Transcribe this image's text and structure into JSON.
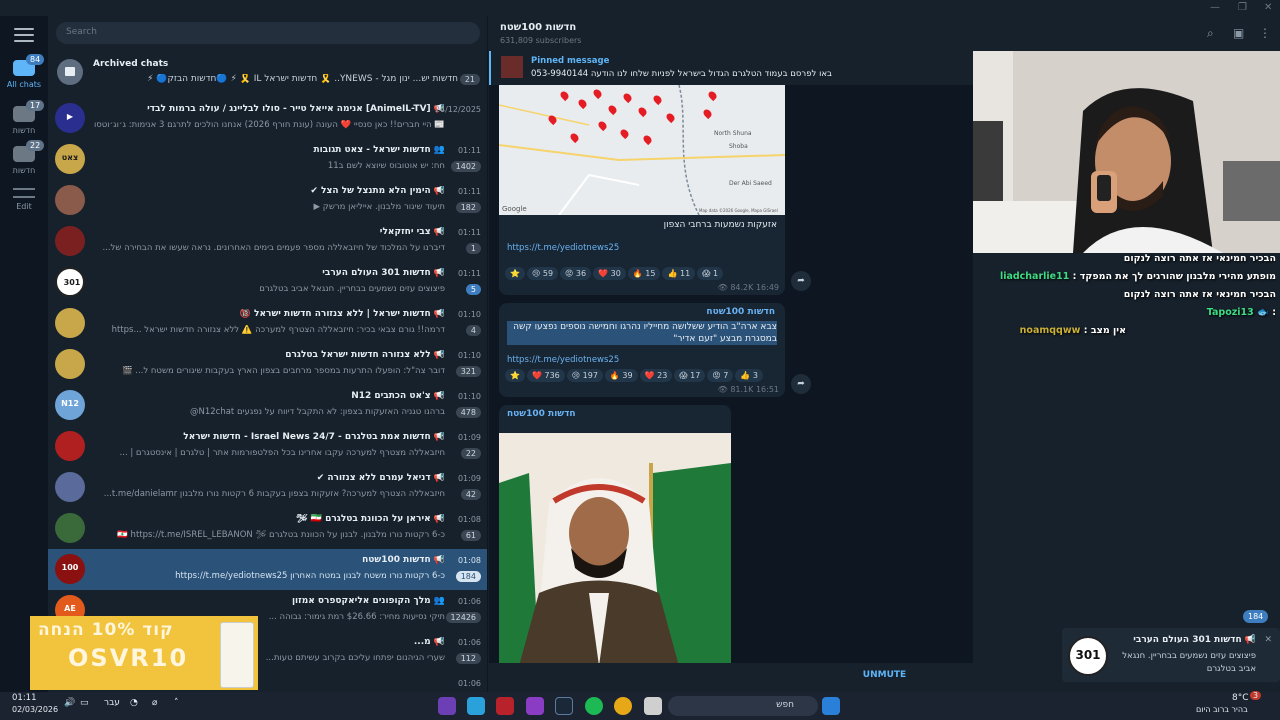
{
  "window": {
    "minimize": "—",
    "maximize": "❐",
    "close": "✕"
  },
  "rail": {
    "folders": [
      {
        "label": "All chats",
        "count": "84"
      },
      {
        "label": "חדשות",
        "count": "17"
      },
      {
        "label": "חדשות",
        "count": "22"
      },
      {
        "label": "Edit",
        "count": ""
      }
    ]
  },
  "search": {
    "placeholder": "Search"
  },
  "archived": {
    "title": "Archived chats",
    "snippet": "חדשות יש... ינון מגל - YNEWS.. 🎗️ חדשות ישראל IL 🎗️ ⚡ 🔵חדשות הבזק🔵 ⚡",
    "count": "21"
  },
  "chats": [
    {
      "avatar": "▶",
      "title": "📢 [AnimeIL-TV] אנימה אייאל טייר - סולו לבליינג / עולה ברמות לבדי",
      "time": "24/12/2025",
      "msg": "📰 היי חברים!! כאן סנסיי ❤️ העונה (עונת חורף 2026) אנחנו הולכים לתרגם 3 אנימות: ג׳וג׳וטסו ...",
      "badge": ""
    },
    {
      "avatar": "צאט",
      "title": "👥 חדשות ישראל - צאט תגובות",
      "time": "01:11",
      "msg": "חח: יש אוטובוס שיוצא לשם ב11",
      "badge": "1402"
    },
    {
      "avatar": "",
      "title": "📢 הימין הלא מתנצל של הצל ✔",
      "time": "01:11",
      "msg": "תיעוד שיגור מלבנון. אייליאן מרשק ▶",
      "badge": "182"
    },
    {
      "avatar": "",
      "title": "📢 צבי יחזקאלי",
      "time": "01:11",
      "msg": "דיברנו על המלכוד של חיזבאללה מספר פעמים בימים האחרונים. נראה שעשו את הבחירה של...",
      "badge": "1"
    },
    {
      "avatar": "301",
      "title": "📢 חדשות 301 העולם הערבי",
      "time": "01:11",
      "msg": "פיצוצים עזים נשמעים בבחריין. חנגאל אביב בטלגרם",
      "badge": "5"
    },
    {
      "avatar": "",
      "title": "📢 חדשות ישראל | ללא צנזורה חדשות ישראל 🔞",
      "time": "01:10",
      "msg": "דרמה!! גורם צבאי בכיר: חיזבאללה הצטרף למערכה ⚠️ ללא צנזורה חדשות ישראל ...https",
      "badge": "4"
    },
    {
      "avatar": "",
      "title": "📢 ללא צנזורה חדשות ישראל בטלגרם",
      "time": "01:10",
      "msg": "דובר צה\"ל: הופעלו התרעות במספר מרחבים בצפון הארץ בעקבות שיגורים משטח ל... 🎬",
      "badge": "321"
    },
    {
      "avatar": "N12",
      "title": "📢 צ'אט הכתבים N12",
      "time": "01:10",
      "msg": "ברהנו טגניה האזעקות בצפון: לא התקבל דיווח על נפגעים N12chat@",
      "badge": "478"
    },
    {
      "avatar": "",
      "title": "📢 חדשות אמת בטלגרם - Israel News 24/7 - חדשות ישראל",
      "time": "01:09",
      "msg": "חיזבאללה מצטרף למערכה עקבו אחרינו בכל הפלטפורמות אתר | טלגרם | אינסטגרם | ...",
      "badge": "22"
    },
    {
      "avatar": "",
      "title": "📢 דניאל עמרם ללא צנזורה ✔",
      "time": "01:09",
      "msg": "חיזבאללה הצטרף למערכה? אזעקות בצפון בעקבות 6 רקטות נורו מלבנון t.me/danielamr...",
      "badge": "42"
    },
    {
      "avatar": "",
      "title": "📢 איראן על הכוונת בטלגרם 🇮🇷 🛩",
      "time": "01:08",
      "msg": "כ-6 רקטות נורו מלבנון. לבנון על הכוונת בטלגרם 🛩 🇱🇧 https://t.me/ISREL_LEBANON",
      "badge": "61"
    },
    {
      "avatar": "100",
      "title": "📢 חדשות 100שטח",
      "time": "01:08",
      "msg": "כ-6 רקטות נורו משטח לבנון במטח האחרון https://t.me/yediotnews25",
      "badge": "184",
      "selected": true
    },
    {
      "avatar": "AE",
      "title": "👥 מלך הקופונים אליאקספרס אמזון",
      "time": "01:06",
      "msg": "תיקי נסיעות מחיר: $26.66 רמת גימור: גבוהה ...",
      "badge": "12426"
    },
    {
      "avatar": "",
      "title": "📢 מ...",
      "time": "01:06",
      "msg": "שערי הגיהנום יפתחו עליכם בקרוב עשיתם טעות...",
      "badge": "112"
    },
    {
      "avatar": "",
      "title": "",
      "time": "01:06",
      "msg": "",
      "badge": ""
    }
  ],
  "chat": {
    "name": "חדשות 100שטח",
    "subscribers": "631,809 subscribers",
    "pinned_label": "Pinned message",
    "pinned_text": "באו לפרסם בעמוד הטלגרם הגדול בישראל לפניות שלחו לנו הודעה 053-9940144"
  },
  "messages": [
    {
      "caption": "אזעקות נשמעות ברחבי הצפון",
      "link": "https://t.me/yediotnews25",
      "reactions": [
        "⭐",
        "😢 59",
        "😡 36",
        "❤️ 30",
        "🔥 15",
        "👍 11",
        "😱 1"
      ],
      "views": "👁 84.2K",
      "time": "16:49",
      "map_labels": [
        "Google",
        "Map data ©2026 Google, Mapa GISrael",
        "Der Abi Saeed",
        "Shoba",
        "North Shuna"
      ]
    },
    {
      "channel": "חדשות 100שטח",
      "text": "צבא ארה\"ב הודיע ששלושה מחייליו נהרגו וחמישה נוספים נפצעו קשה במסגרת מבצע \"זעם אדיר\"",
      "link": "https://t.me/yediotnews25",
      "reactions": [
        "⭐",
        "❤️ 736",
        "😢 197",
        "🔥 39",
        "❤️ 23",
        "😱 17",
        "😡 7",
        "👍 3"
      ],
      "views": "👁 81.1K",
      "time": "16:51"
    },
    {
      "channel": "חדשות 100שטח"
    }
  ],
  "unmute": "UNMUTE",
  "unread_badge": "184",
  "stream_chat": [
    {
      "user": "",
      "text": "הבכיר חמינאי אז אתה רוצה לנקום"
    },
    {
      "user": "liadcharlie11",
      "text": "מופתע מהירי מלבנון שהורגים לך את המפקד :"
    },
    {
      "user": "",
      "text": "הבכיר חמינאי אז אתה רוצה לנקום"
    },
    {
      "user": "Tapozi13",
      "text": ": 🐟"
    },
    {
      "user": "noamqqww",
      "text": "אין מצב :"
    }
  ],
  "notification": {
    "avatar": "301",
    "title": "📢 חדשות 301 העולם הערבי",
    "body": "פיצוצים עזים נשמעים בבחריין. חנגאל אביב בטלגרם",
    "close": "✕"
  },
  "ad": {
    "line1": "קוד 10% הנחה",
    "line2": "OSVR10"
  },
  "taskbar": {
    "time": "01:11",
    "date": "02/03/2026",
    "lang": "עבר",
    "search": "חפש",
    "weather_temp": "8°C",
    "weather_desc": "בהיר ברוב היום",
    "weather_badge": "3"
  }
}
